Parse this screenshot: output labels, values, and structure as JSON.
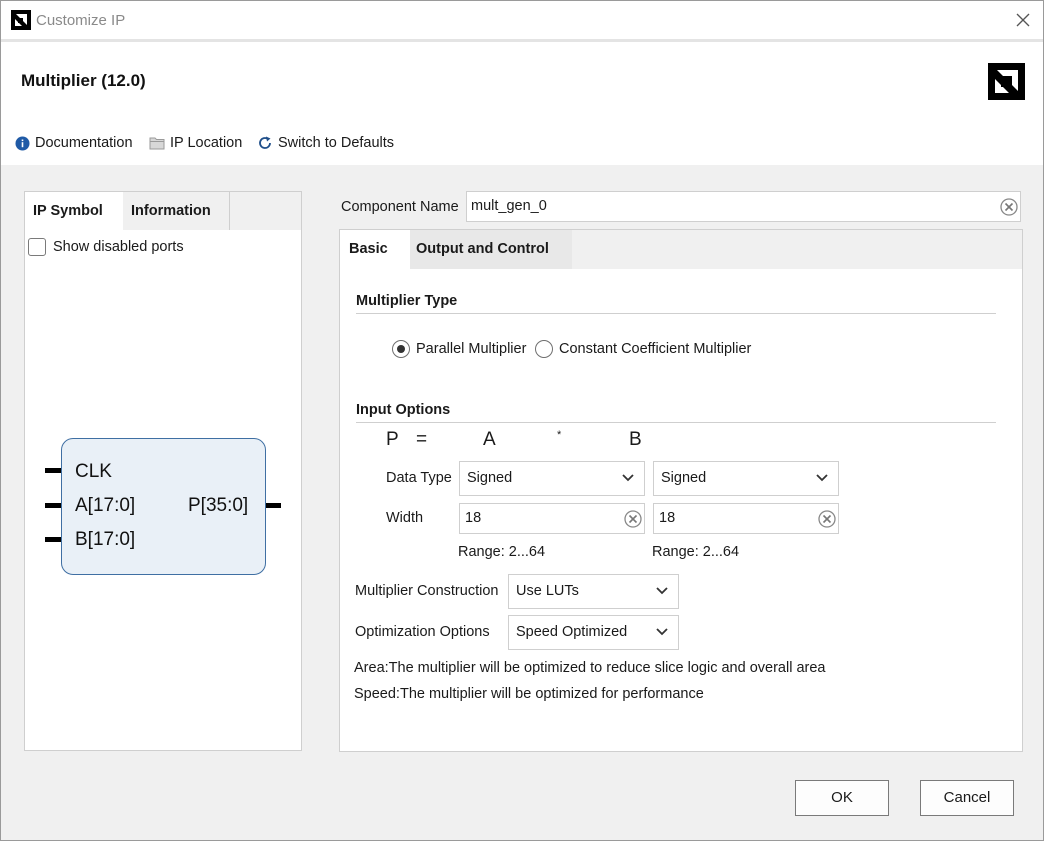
{
  "window": {
    "title": "Customize IP"
  },
  "header": {
    "ip_title": "Multiplier (12.0)",
    "toolbar": {
      "documentation": "Documentation",
      "ip_location": "IP Location",
      "switch_defaults": "Switch to Defaults"
    }
  },
  "left": {
    "tabs": [
      "IP Symbol",
      "Information"
    ],
    "show_disabled_ports": "Show disabled ports",
    "symbol": {
      "inputs": [
        "CLK",
        "A[17:0]",
        "B[17:0]"
      ],
      "output": "P[35:0]"
    }
  },
  "component": {
    "label": "Component Name",
    "value": "mult_gen_0"
  },
  "tabs": [
    "Basic",
    "Output and Control"
  ],
  "multiplier_type": {
    "heading": "Multiplier Type",
    "options": [
      "Parallel Multiplier",
      "Constant Coefficient Multiplier"
    ],
    "selected": "Parallel Multiplier"
  },
  "input_options": {
    "heading": "Input Options",
    "equation": {
      "p": "P",
      "eq": "=",
      "a": "A",
      "op": "*",
      "b": "B"
    },
    "data_type_label": "Data Type",
    "a_data_type": "Signed",
    "b_data_type": "Signed",
    "width_label": "Width",
    "a_width": "18",
    "b_width": "18",
    "a_range": "Range: 2...64",
    "b_range": "Range: 2...64"
  },
  "construction": {
    "label": "Multiplier Construction",
    "value": "Use LUTs"
  },
  "optimization": {
    "label": "Optimization Options",
    "value": "Speed Optimized"
  },
  "descriptions": {
    "area": "Area:The multiplier will be optimized to reduce slice logic and overall area",
    "speed": "Speed:The multiplier will be optimized for performance"
  },
  "buttons": {
    "ok": "OK",
    "cancel": "Cancel"
  },
  "colors": {
    "symbol_fill": "#e9f0f7",
    "symbol_border": "#3f6fa3",
    "info_icon": "#1f5aa6"
  }
}
